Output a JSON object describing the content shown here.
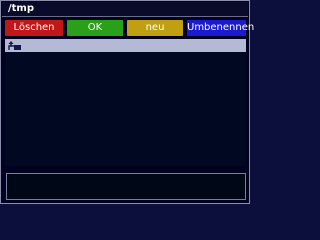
{
  "window": {
    "title": "/tmp"
  },
  "buttons": {
    "red_label": "Löschen",
    "green_label": "OK",
    "yellow_label": "neu",
    "blue_label": "Umbenennen"
  },
  "filelist": {
    "items": [
      {
        "icon": "up-directory-icon",
        "label": ""
      }
    ]
  },
  "status": {
    "text": ""
  },
  "colors": {
    "background": "#000020",
    "red": "#c01818",
    "green": "#2aa01a",
    "yellow": "#c0a010",
    "blue": "#1a1ad0",
    "selection": "#b4bad6"
  }
}
